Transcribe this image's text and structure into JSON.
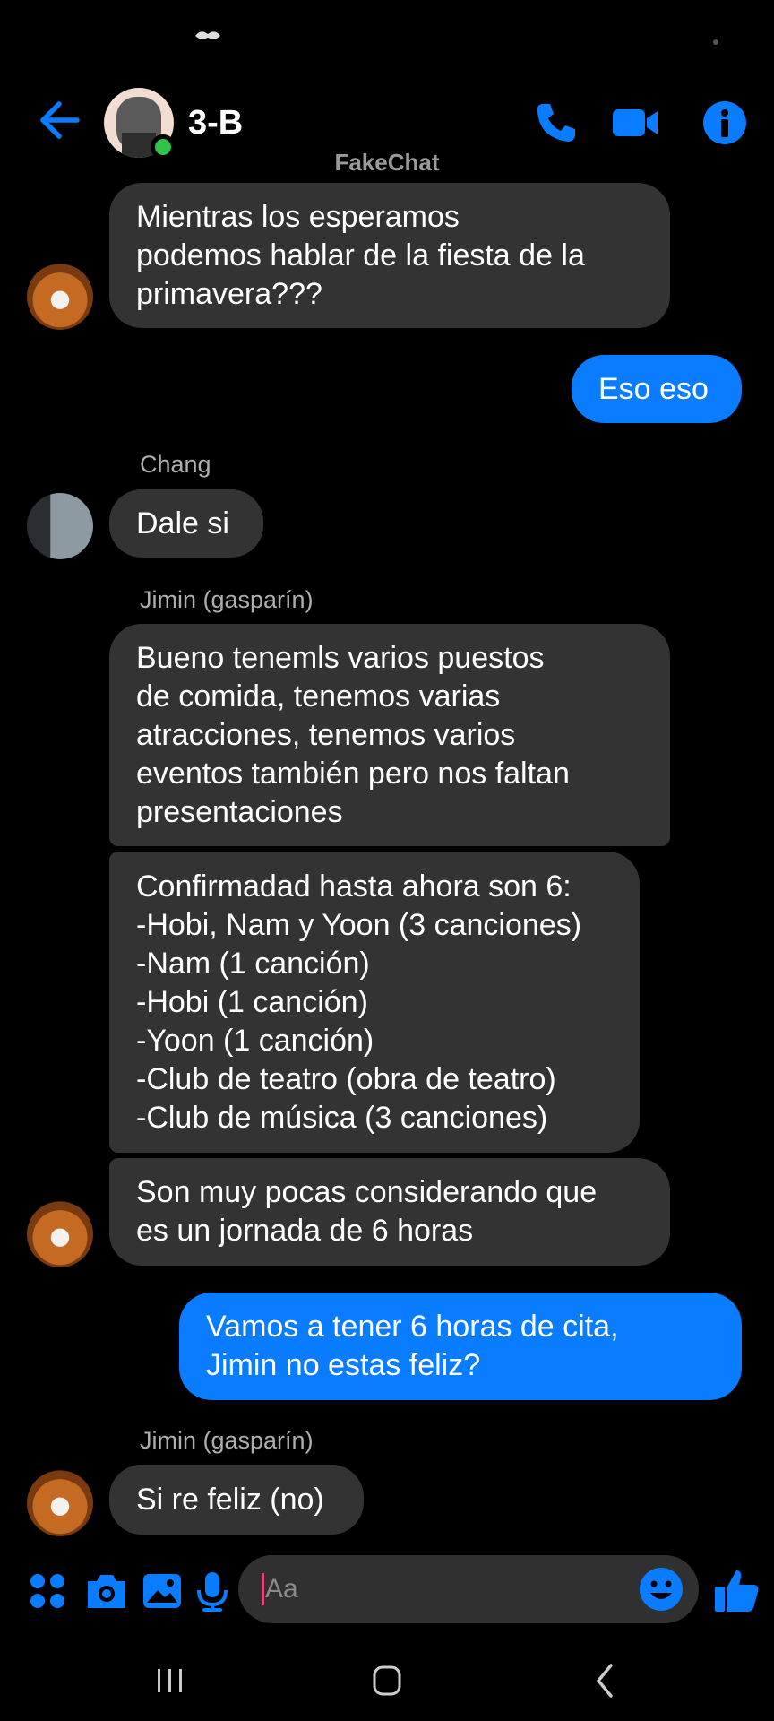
{
  "header": {
    "title": "3-B",
    "watermark": "FakeChat"
  },
  "colors": {
    "accent": "#0a7cff",
    "incoming_bubble": "#333333",
    "online": "#31c347"
  },
  "messages": [
    {
      "type": "in",
      "text": "Mientras los esperamos\npodemos hablar de la fiesta de la\nprimavera???"
    },
    {
      "type": "out",
      "text": "Eso eso"
    },
    {
      "type": "in",
      "sender": "Chang",
      "text": "Dale si"
    },
    {
      "type": "in",
      "sender": "Jimin (gasparín)",
      "text": "Bueno tenemls varios puestos\nde comida, tenemos varias\natracciones, tenemos varios\neventos también pero nos faltan\npresentaciones"
    },
    {
      "type": "in",
      "text": "Confirmadad hasta ahora son 6:\n-Hobi, Nam y Yoon (3 canciones)\n-Nam (1 canción)\n-Hobi (1 canción)\n-Yoon (1 canción)\n-Club de teatro (obra de teatro)\n-Club de música (3 canciones)"
    },
    {
      "type": "in",
      "text": "Son muy pocas considerando que\nes un jornada de 6 horas"
    },
    {
      "type": "out",
      "text": "Vamos a tener 6 horas de cita,\nJimin no estas feliz?"
    },
    {
      "type": "in",
      "sender": "Jimin (gasparín)",
      "text": "Si re feliz (no)"
    }
  ],
  "composer": {
    "placeholder": "Aa",
    "icons": [
      "apps-icon",
      "camera-icon",
      "gallery-icon",
      "microphone-icon",
      "emoji-icon",
      "like-icon"
    ]
  },
  "navbar": {
    "icons": [
      "recent-apps-icon",
      "home-icon",
      "back-nav-icon"
    ]
  }
}
